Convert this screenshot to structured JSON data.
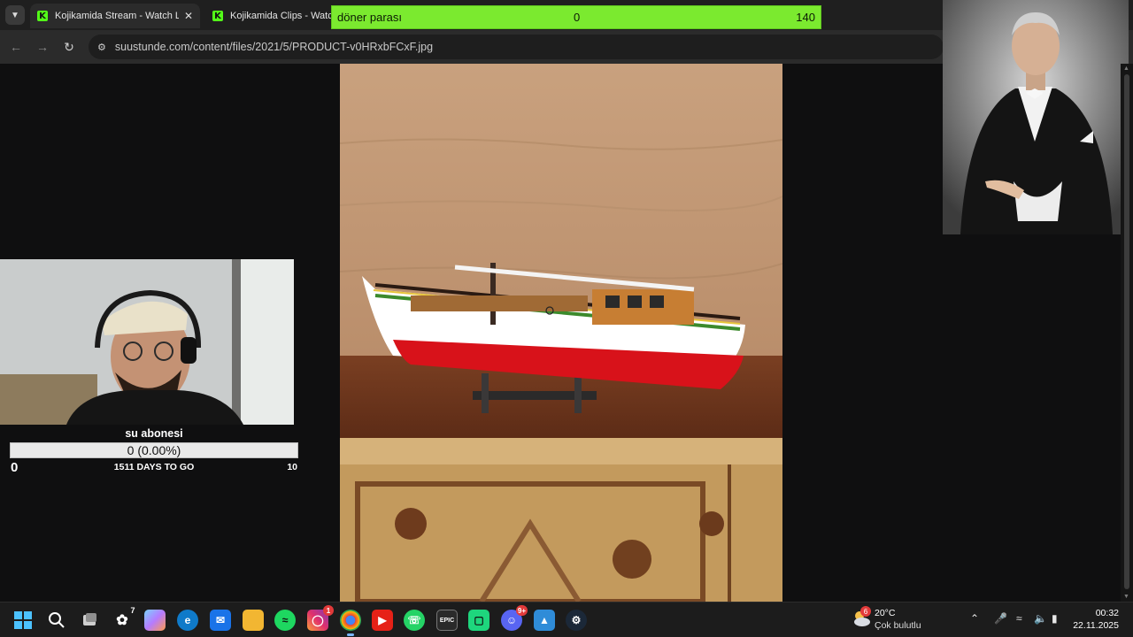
{
  "browser": {
    "tabs": [
      {
        "title": "Kojikamida Stream - Watch Live",
        "close": "✕"
      },
      {
        "title": "Kojikamida Clips - Watch"
      }
    ],
    "url": "suustunde.com/content/files/2021/5/PRODUCT-v0HRxbFCxF.jpg"
  },
  "overlay_goal": {
    "label": "döner parası",
    "current": "0",
    "target": "140",
    "progress": 0,
    "color": "#7bea2f"
  },
  "sub_goal": {
    "title": "su abonesi",
    "bar_text": "0 (0.00%)",
    "start": "0",
    "days_left": "1511 DAYS TO GO",
    "end": "10",
    "progress": 0
  },
  "taskbar": {
    "badges": {
      "fire": "7",
      "instagram": "1",
      "discord": "9+"
    },
    "weather": {
      "badge": "6",
      "temp": "20°C",
      "desc": "Çok bulutlu"
    },
    "clock": {
      "time": "00:32",
      "date": "22.11.2025"
    }
  }
}
